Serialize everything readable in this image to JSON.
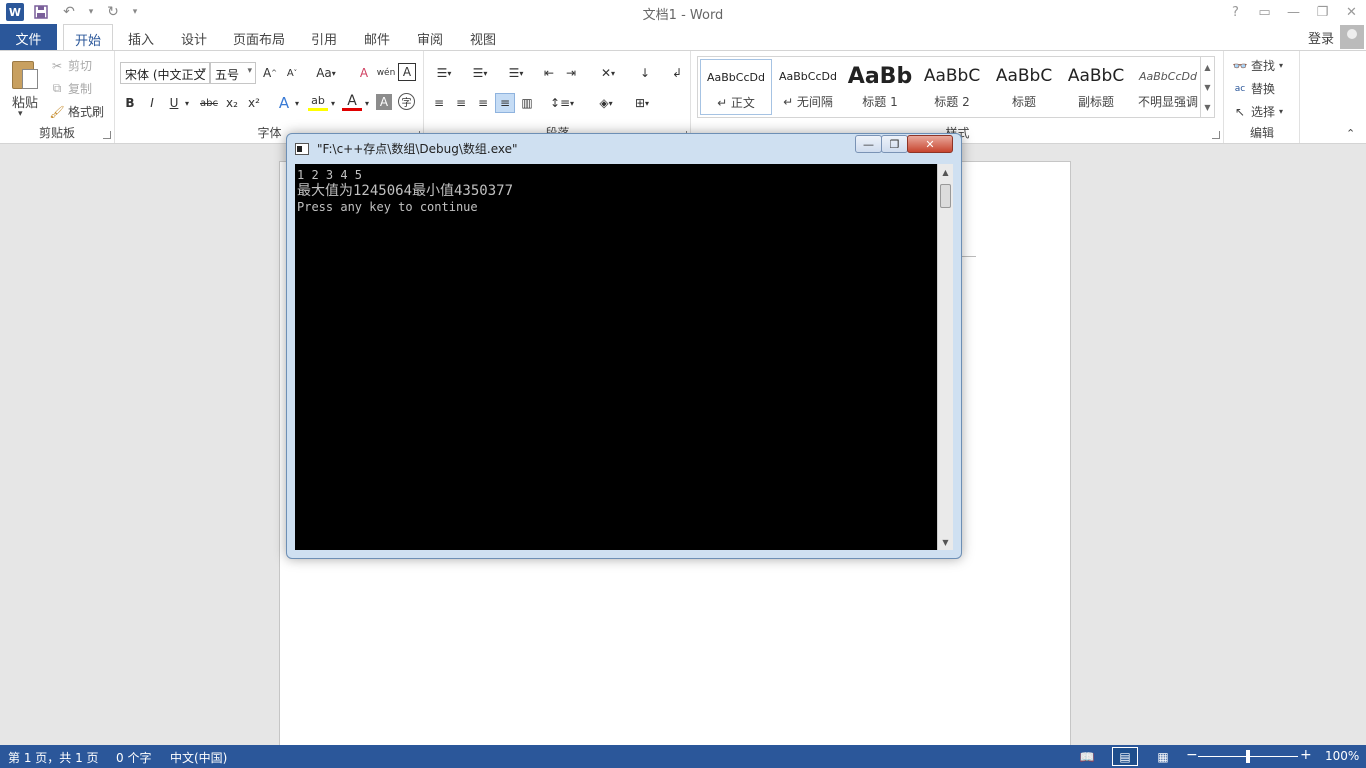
{
  "window": {
    "title": "文档1 - Word"
  },
  "qat": {
    "word_icon": "W",
    "save_icon": "save-icon",
    "undo_icon": "undo-icon",
    "redo_icon": "redo-icon",
    "customize_icon": "customize-icon"
  },
  "tabs": {
    "file": "文件",
    "home": "开始",
    "insert": "插入",
    "design": "设计",
    "layout": "页面布局",
    "references": "引用",
    "mailings": "邮件",
    "review": "审阅",
    "view": "视图"
  },
  "account": {
    "login": "登录"
  },
  "clipboard": {
    "group_label": "剪贴板",
    "paste": "粘贴",
    "cut": "剪切",
    "copy": "复制",
    "format_painter": "格式刷"
  },
  "font": {
    "group_label": "字体",
    "font_name": "宋体 (中文正文",
    "font_size": "五号",
    "bold": "B",
    "italic": "I",
    "underline": "U",
    "strike": "abc",
    "subscript": "x₂",
    "superscript": "x²",
    "grow": "A^",
    "shrink": "A˅",
    "case": "Aa",
    "clear": "A",
    "phonetic": "wén",
    "border_char": "A",
    "highlight": "ab",
    "font_color": "A",
    "char_shade": "A",
    "enclose": "字"
  },
  "paragraph": {
    "group_label": "段落"
  },
  "styles": {
    "group_label": "样式",
    "items": [
      {
        "preview": "AaBbCcDd",
        "name": "↵ 正文"
      },
      {
        "preview": "AaBbCcDd",
        "name": "↵ 无间隔"
      },
      {
        "preview": "AaBb",
        "name": "标题 1"
      },
      {
        "preview": "AaBbC",
        "name": "标题 2"
      },
      {
        "preview": "AaBbC",
        "name": "标题"
      },
      {
        "preview": "AaBbC",
        "name": "副标题"
      },
      {
        "preview": "AaBbCcDd",
        "name": "不明显强调"
      }
    ]
  },
  "editing": {
    "group_label": "编辑",
    "find": "查找",
    "replace": "替换",
    "select": "选择"
  },
  "console": {
    "title": "\"F:\\c++存点\\数组\\Debug\\数组.exe\"",
    "lines": [
      "1 2 3 4 5",
      "最大值为1245064最小值4350377",
      "Press any key to continue"
    ]
  },
  "status": {
    "page": "第 1 页，共 1 页",
    "words": "0 个字",
    "lang": "中文(中国)",
    "zoom": "100%"
  }
}
